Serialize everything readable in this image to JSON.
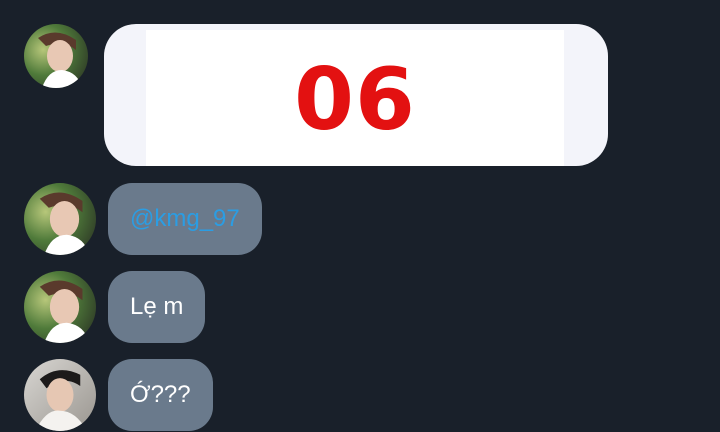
{
  "colors": {
    "background": "#19202a",
    "bubble": "#6a7a8c",
    "mention": "#2b9de3",
    "image_number": "#e31111"
  },
  "messages": [
    {
      "type": "image",
      "avatar_icon": "user-avatar-1",
      "image_text": "06"
    },
    {
      "type": "text",
      "avatar_icon": "user-avatar-1",
      "text": "@kmg_97",
      "is_mention": true
    },
    {
      "type": "text",
      "avatar_icon": "user-avatar-1",
      "text": "Lẹ m"
    },
    {
      "type": "text",
      "avatar_icon": "user-avatar-2",
      "text": "Ớ???"
    }
  ]
}
